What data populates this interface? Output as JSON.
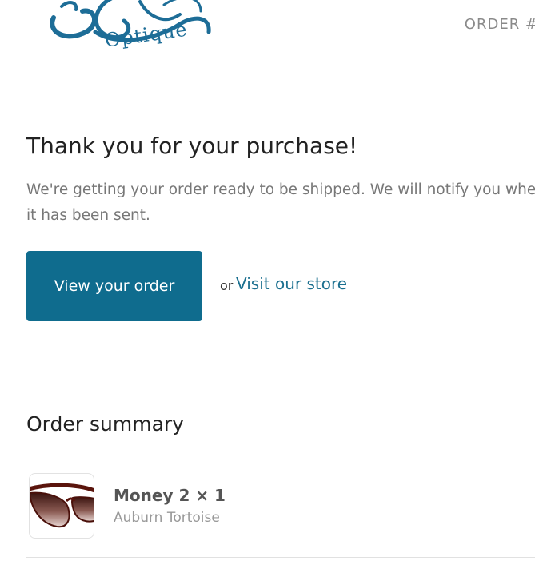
{
  "header": {
    "logo_text": "Optique",
    "order_number": "ORDER #"
  },
  "confirmation": {
    "heading": "Thank you for your purchase!",
    "message": "We're getting your order ready to be shipped. We will notify you when it has been sent.",
    "view_order_label": "View your order",
    "or_text": "or",
    "visit_store_label": "Visit our store"
  },
  "summary": {
    "title": "Order summary",
    "items": [
      {
        "name": "Money 2 × 1",
        "variant": "Auburn Tortoise",
        "icon": "sunglasses-product-image"
      }
    ]
  },
  "colors": {
    "brand": "#1d6d97",
    "button": "#0f6c8e",
    "link": "#1a6f8f"
  }
}
